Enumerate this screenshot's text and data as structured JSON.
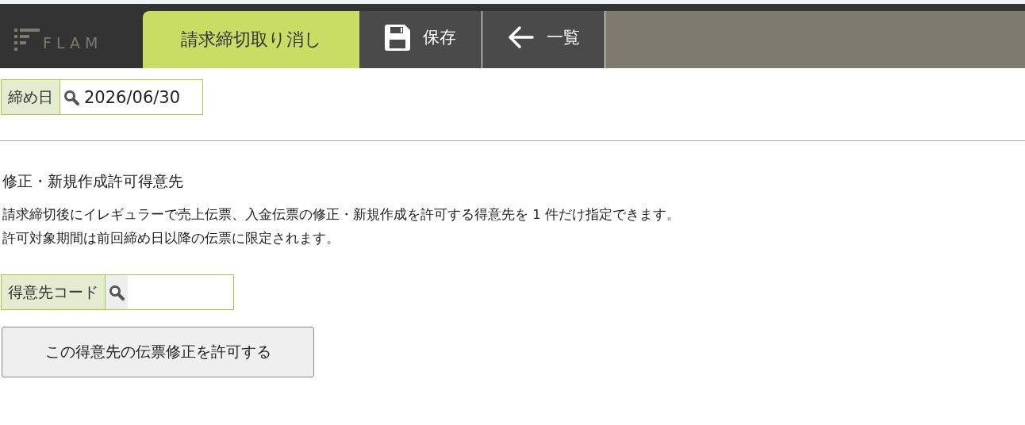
{
  "header": {
    "logo": "FLAM",
    "tabs": [
      {
        "kind": "tab",
        "label": "請求締切取り消し",
        "selected": true
      },
      {
        "kind": "save",
        "label": "保存",
        "selected": false
      },
      {
        "kind": "back",
        "label": "一覧",
        "selected": false
      }
    ]
  },
  "closing_date": {
    "label": "締め日",
    "value": "2026/06/30"
  },
  "section": {
    "title": "修正・新規作成許可得意先",
    "description": [
      "請求締切後にイレギュラーで売上伝票、入金伝票の修正・新規作成を許可する得意先を 1 件だけ指定できます。",
      "許可対象期間は前回締め日以降の伝票に限定されます。"
    ]
  },
  "customer_code": {
    "label": "得意先コード"
  },
  "allow_button": "この得意先の伝票修正を許可する"
}
